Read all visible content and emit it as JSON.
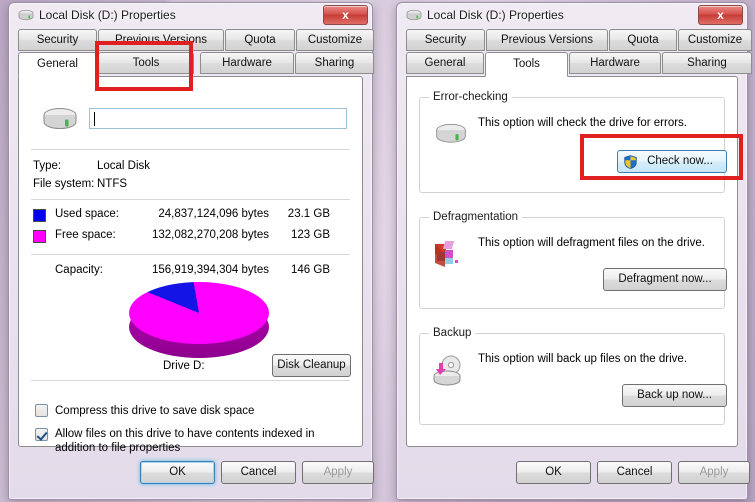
{
  "desktop": {
    "background_color": "#c9bcd0"
  },
  "dialogs": {
    "left": {
      "title": "Local Disk (D:) Properties",
      "title_icon": "hard-drive-icon",
      "close_label": "x",
      "tabs_row1": [
        {
          "label": "Security",
          "active": false
        },
        {
          "label": "Previous Versions",
          "active": false
        },
        {
          "label": "Quota",
          "active": false
        },
        {
          "label": "Customize",
          "active": false
        }
      ],
      "tabs_row2": [
        {
          "label": "General",
          "active": true
        },
        {
          "label": "Tools",
          "active": false
        },
        {
          "label": "Hardware",
          "active": false
        },
        {
          "label": "Sharing",
          "active": false
        }
      ],
      "general": {
        "volume_label_value": "",
        "volume_label_placeholder": "",
        "type_label": "Type:",
        "type_value": "Local Disk",
        "filesystem_label": "File system:",
        "filesystem_value": "NTFS",
        "used_label": "Used space:",
        "used_bytes": "24,837,124,096 bytes",
        "used_gb": "23.1 GB",
        "used_color": "#0000ee",
        "free_label": "Free space:",
        "free_bytes": "132,082,270,208 bytes",
        "free_gb": "123 GB",
        "free_color": "#ff00ff",
        "capacity_label": "Capacity:",
        "capacity_bytes": "156,919,394,304 bytes",
        "capacity_gb": "146 GB",
        "drive_caption": "Drive D:",
        "disk_cleanup_label": "Disk Cleanup",
        "compress_label": "Compress this drive to save disk space",
        "compress_checked": false,
        "index_label": "Allow files on this drive to have contents indexed in addition to file properties",
        "index_checked": true
      },
      "footer": {
        "ok_label": "OK",
        "cancel_label": "Cancel",
        "apply_label": "Apply",
        "ok_focused": true,
        "apply_disabled": true
      },
      "highlight": {
        "target": "tab-tools",
        "color": "#e02020"
      }
    },
    "right": {
      "title": "Local Disk (D:) Properties",
      "title_icon": "hard-drive-icon",
      "close_label": "x",
      "tabs_row1": [
        {
          "label": "Security",
          "active": false
        },
        {
          "label": "Previous Versions",
          "active": false
        },
        {
          "label": "Quota",
          "active": false
        },
        {
          "label": "Customize",
          "active": false
        }
      ],
      "tabs_row2": [
        {
          "label": "General",
          "active": false
        },
        {
          "label": "Tools",
          "active": true
        },
        {
          "label": "Hardware",
          "active": false
        },
        {
          "label": "Sharing",
          "active": false
        }
      ],
      "tools": {
        "error_checking": {
          "title": "Error-checking",
          "description": "This option will check the drive for errors.",
          "button_label": "Check now...",
          "button_icon": "uac-shield-icon",
          "icon": "hard-drive-icon"
        },
        "defragmentation": {
          "title": "Defragmentation",
          "description": "This option will defragment files on the drive.",
          "button_label": "Defragment now...",
          "icon": "defrag-icon"
        },
        "backup": {
          "title": "Backup",
          "description": "This option will back up files on the drive.",
          "button_label": "Back up now...",
          "icon": "backup-disk-icon"
        }
      },
      "footer": {
        "ok_label": "OK",
        "cancel_label": "Cancel",
        "apply_label": "Apply",
        "ok_focused": false,
        "apply_disabled": true
      },
      "highlight": {
        "target": "check-now-button",
        "color": "#e02020"
      }
    }
  },
  "chart_data": {
    "type": "pie",
    "title": "Drive D:",
    "categories": [
      "Used space",
      "Free space"
    ],
    "values": [
      24837124096,
      132082270208
    ],
    "value_labels": [
      "23.1 GB",
      "123 GB"
    ],
    "percentages": [
      15.8,
      84.2
    ],
    "colors": [
      "#0000ee",
      "#ff00ff"
    ],
    "total": 156919394304,
    "total_label": "146 GB",
    "legend": "inline-left",
    "style": "3d"
  }
}
